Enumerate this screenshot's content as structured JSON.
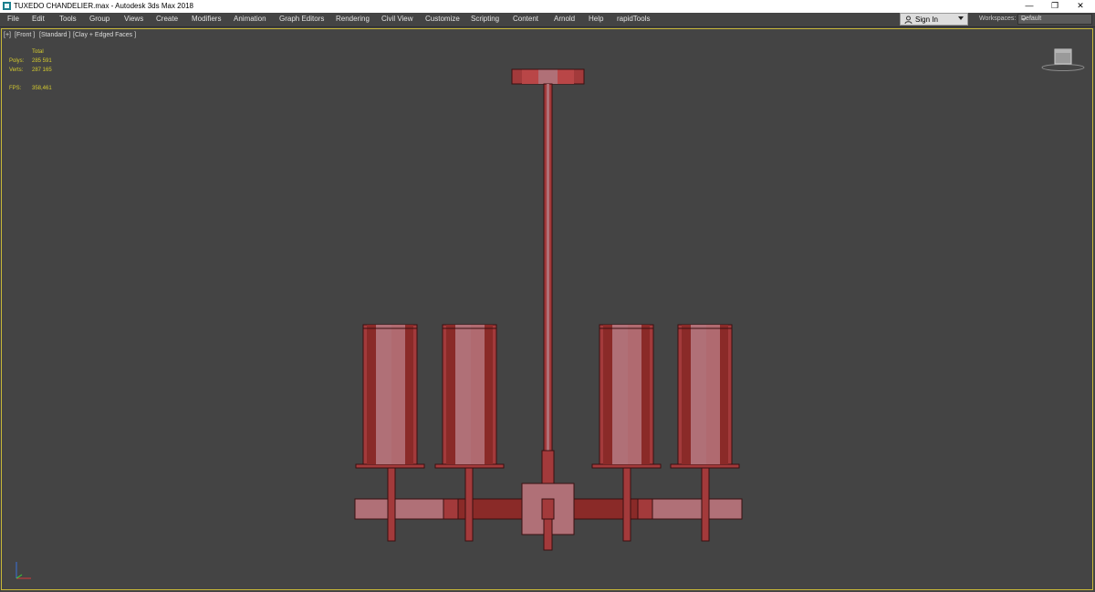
{
  "titlebar": {
    "title": "TUXEDO CHANDELIER.max - Autodesk 3ds Max 2018",
    "minimize_glyph": "—",
    "restore_glyph": "❐",
    "close_glyph": "✕"
  },
  "menu": {
    "items": [
      "File",
      "Edit",
      "Tools",
      "Group",
      "Views",
      "Create",
      "Modifiers",
      "Animation",
      "Graph Editors",
      "Rendering",
      "Civil View",
      "Customize",
      "Scripting",
      "Content",
      "Arnold",
      "Help",
      "rapidTools"
    ]
  },
  "account": {
    "signin_label": "Sign In"
  },
  "workspaces": {
    "label": "Workspaces:",
    "value": "Default"
  },
  "viewport": {
    "label_plus": "[+]",
    "label_view": "[Front ]",
    "label_shading": "[Standard ]",
    "label_style": "[Clay + Edged Faces ]"
  },
  "stats": {
    "total_label": "Total",
    "polys_label": "Polys:",
    "polys_value": "285 591",
    "verts_label": "Verts:",
    "verts_value": "287 165",
    "fps_label": "FPS:",
    "fps_value": "358,461"
  },
  "colors": {
    "viewport_bg": "#444444",
    "stats_text": "#d6cc2e",
    "model_light": "#b06a70",
    "model_mid": "#a8383a",
    "model_dark": "#8a2a28"
  }
}
